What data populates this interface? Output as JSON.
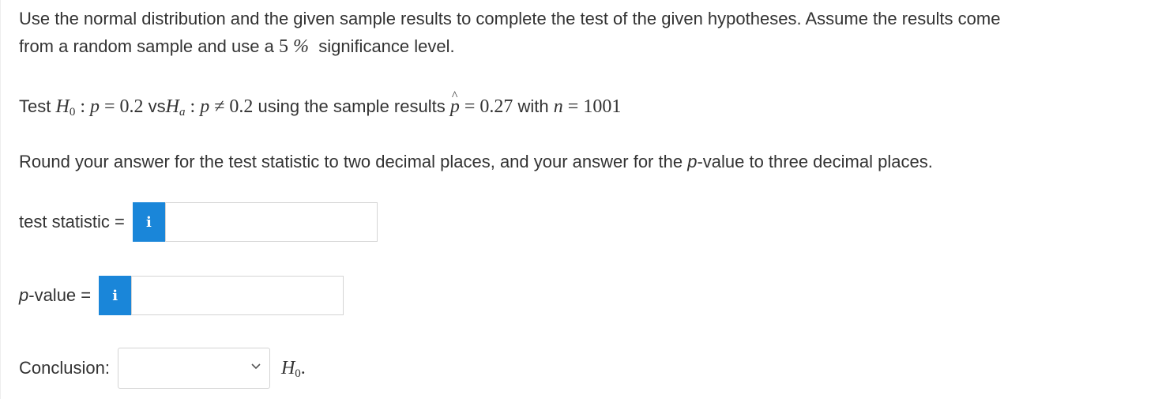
{
  "instructions": {
    "line1": "Use the normal distribution and the given sample results to complete the test of the given hypotheses. Assume the results come",
    "line2_pre": "from a random sample and use a",
    "significance_value": "5",
    "percent_sign": "%",
    "line2_post": "significance level."
  },
  "hypotheses": {
    "test_word": "Test",
    "h0_symbol": "H",
    "h0_sub": "0",
    "colon": ":",
    "p_symbol": "p",
    "eq": "=",
    "p0": "0.2",
    "vs_word": "vs",
    "ha_symbol": "H",
    "ha_sub": "a",
    "neq": "≠",
    "using_text": "using the sample results",
    "phat_symbol": "p",
    "phat_value": "0.27",
    "with_word": "with",
    "n_symbol": "n",
    "n_value": "1001"
  },
  "rounding_prefix": "Round your answer for the test statistic to two decimal places, and your answer for the ",
  "rounding_p": "p",
  "rounding_suffix": "-value to three decimal places.",
  "test_statistic": {
    "label": "test statistic =",
    "info_icon": "i",
    "value": ""
  },
  "p_value": {
    "label_italic": "p",
    "label_rest": "-value =",
    "info_icon": "i",
    "value": ""
  },
  "conclusion": {
    "label": "Conclusion:",
    "selected": "",
    "h_symbol": "H",
    "h_sub": "0",
    "period": "."
  },
  "colors": {
    "info_button": "#1a86d9",
    "text": "#333333",
    "border": "#d4d4d4"
  }
}
